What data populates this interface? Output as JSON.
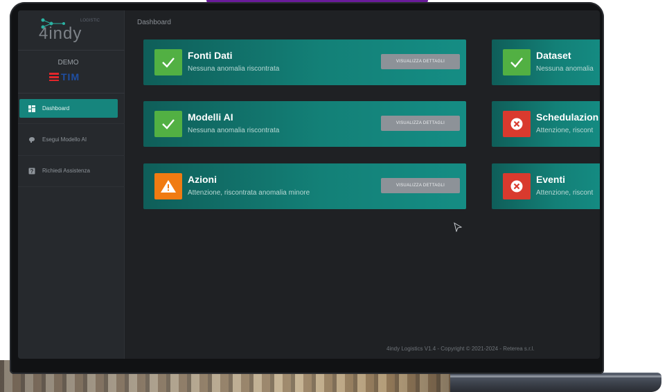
{
  "logo": {
    "text": "4indy",
    "tagline": "LOGISTIC"
  },
  "sidebar": {
    "tenant": "DEMO",
    "brand_logo_text": "TIM",
    "items": [
      {
        "label": "Dashboard",
        "icon": "dashboard-grid-icon",
        "active": true
      },
      {
        "label": "Esegui Modello AI",
        "icon": "brain-icon",
        "active": false
      },
      {
        "label": "Richiedi Assistenza",
        "icon": "help-icon",
        "active": false
      }
    ]
  },
  "breadcrumb": "Dashboard",
  "cards": [
    {
      "title": "Fonti Dati",
      "subtitle": "Nessuna anomalia riscontrata",
      "status": "ok",
      "button": "VISUALIZZA DETTAGLI"
    },
    {
      "title": "Dataset",
      "subtitle": "Nessuna anomalia",
      "status": "ok"
    },
    {
      "title": "Modelli AI",
      "subtitle": "Nessuna anomalia riscontrata",
      "status": "ok",
      "button": "VISUALIZZA DETTAGLI"
    },
    {
      "title": "Schedulazion",
      "subtitle": "Attenzione, riscont",
      "status": "error"
    },
    {
      "title": "Azioni",
      "subtitle": "Attenzione, riscontrata anomalia minore",
      "status": "warning",
      "button": "VISUALIZZA DETTAGLI"
    },
    {
      "title": "Eventi",
      "subtitle": "Attenzione, riscont",
      "status": "error"
    }
  ],
  "footer": "4indy Logistics V1.4 - Copyright © 2021-2024 - Reterea s.r.l.",
  "colors": {
    "accent": "#16857d",
    "card": "#138077",
    "ok": "#52b043",
    "warning": "#f07b12",
    "error": "#d93a2e"
  }
}
